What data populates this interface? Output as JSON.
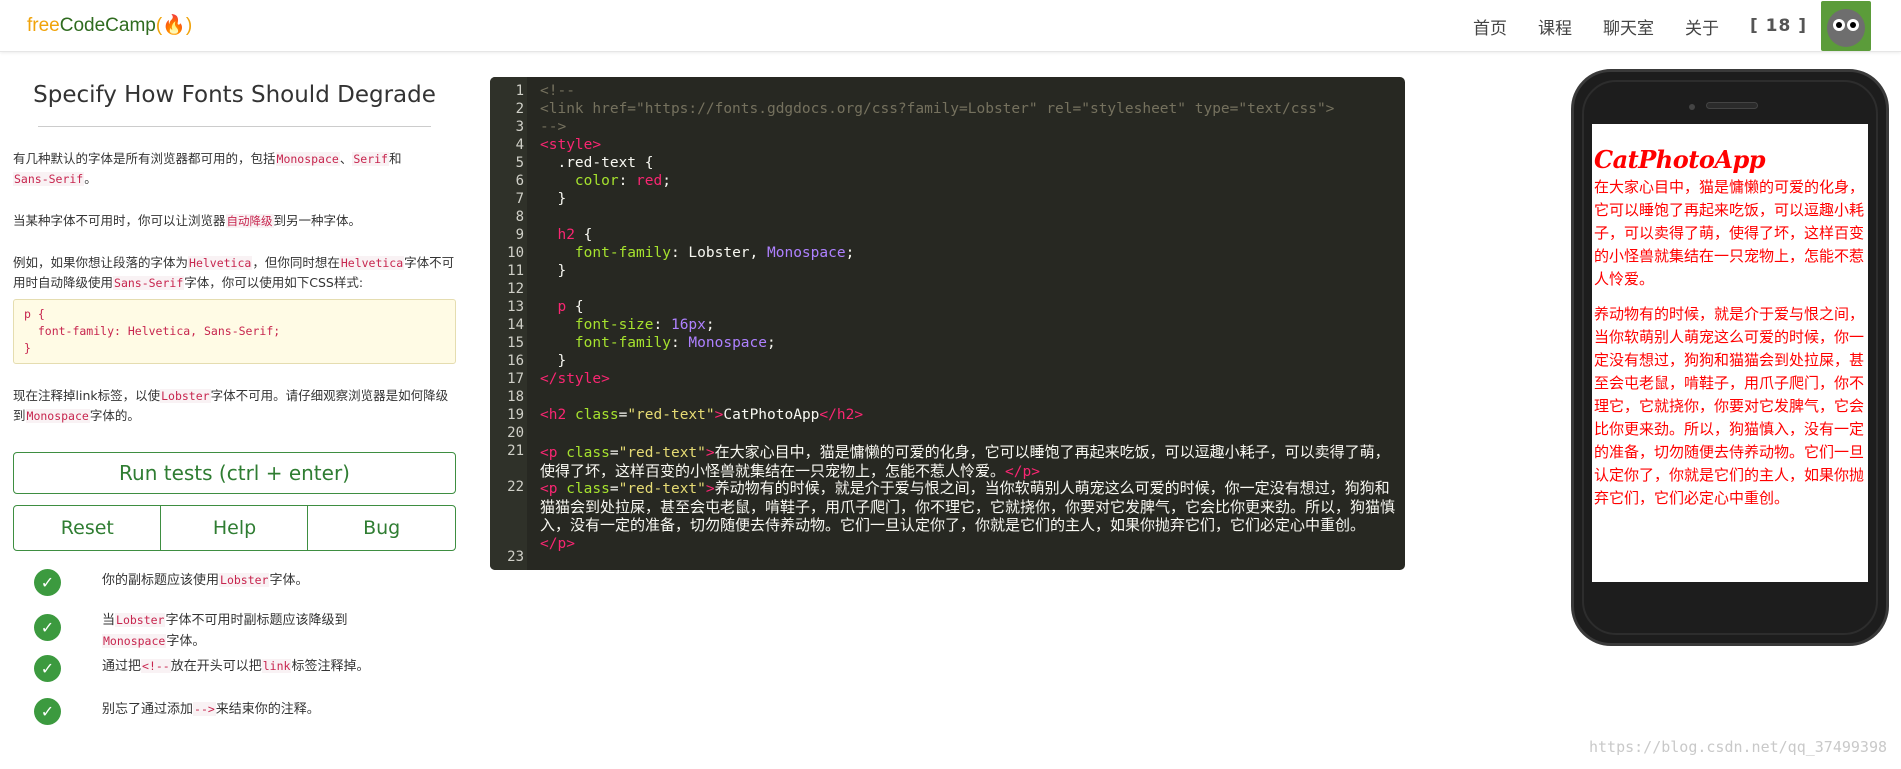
{
  "brand": {
    "part1": "free",
    "part2": "CodeCamp",
    "part3": "(🔥)"
  },
  "nav": {
    "items": [
      "首页",
      "课程",
      "聊天室",
      "关于"
    ],
    "count": "[ 18 ]"
  },
  "left": {
    "title": "Specify How Fonts Should Degrade",
    "p1": {
      "a": "有几种默认的字体是所有浏览器都可用的，包括",
      "k1": "Monospace",
      "b": "、",
      "k2": "Serif",
      "c": "和",
      "k3": "Sans-Serif",
      "d": "。"
    },
    "p2": {
      "a": "当某种字体不可用时，你可以让浏览器",
      "k1": "自动降级",
      "b": "到另一种字体。"
    },
    "p3": {
      "a": "例如，如果你想让段落的字体为",
      "k1": "Helvetica",
      "b": "，但你同时想在",
      "k2": "Helvetica",
      "c": "字体不可用时自动降级使用",
      "k3": "Sans-Serif",
      "d": "字体，你可以使用如下CSS样式:"
    },
    "code": [
      "p {",
      "  font-family: Helvetica, Sans-Serif;",
      "}"
    ],
    "p4": {
      "a": "现在注释掉link标签，以使",
      "k1": "Lobster",
      "b": "字体不可用。请仔细观察浏览器是如何降级到",
      "k2": "Monospace",
      "c": "字体的。"
    },
    "run_label": "Run tests (ctrl + enter)",
    "reset_label": "Reset",
    "help_label": "Help",
    "bug_label": "Bug",
    "tests": [
      {
        "a": "你的副标题应该使用",
        "k": "Lobster",
        "b": "字体。"
      },
      {
        "a": "当",
        "k": "Lobster",
        "b": "字体不可用时副标题应该降级到",
        "k2": "Monospace",
        "c": "字体。"
      },
      {
        "a": "通过把",
        "k": "<!--",
        "b": "放在开头可以把",
        "k2": "link",
        "c": "标签注释掉。"
      },
      {
        "a": "别忘了通过添加",
        "k": "-->",
        "b": "来结束你的注释。"
      }
    ]
  },
  "editor": {
    "line1": "<!--",
    "line2": "<link href=\"https://fonts.gdgdocs.org/css?family=Lobster\" rel=\"stylesheet\" type=\"text/css\">",
    "line3": "-->",
    "line4": "<style>",
    "line5": "  .red-text {",
    "line6_prop": "    color",
    "line6_val": "red",
    "line7": "  }",
    "line9": "  h2 {",
    "line10_prop": "    font-family",
    "line10_val1": "Lobster",
    "line10_val2": "Monospace",
    "line11": "  }",
    "line13": "  p {",
    "line14_prop": "    font-size",
    "line14_val": "16px",
    "line15_prop": "    font-family",
    "line15_val": "Monospace",
    "line16": "  }",
    "line17": "</style>",
    "line19_open": "<h2",
    "line19_attr": "class",
    "line19_str": "\"red-text\"",
    "line19_text": "CatPhotoApp",
    "line19_close": "</h2>",
    "line21_open": "<p",
    "line21_attr": "class",
    "line21_str": "\"red-text\"",
    "line21_text": "在大家心目中，猫是慵懒的可爱的化身，它可以睡饱了再起来吃饭，可以逗趣小耗子，可以卖得了萌，使得了坏，这样百变的小怪兽就集结在一只宠物上，怎能不惹人怜爱。",
    "line22_text": "养动物有的时候，就是介于爱与恨之间，当你软萌别人萌宠这么可爱的时候，你一定没有想过，狗狗和猫猫会到处拉屎，甚至会屯老鼠，啃鞋子，用爪子爬门，你不理它，它就挠你，你要对它发脾气，它会比你更来劲。所以，狗猫慎入，没有一定的准备，切勿随便去侍养动物。它们一旦认定你了，你就是它们的主人，如果你抛弃它们，它们必定心中重创。",
    "p_close": "</p>",
    "line_numbers": [
      "1",
      "2",
      "3",
      "4",
      "5",
      "6",
      "7",
      "8",
      "9",
      "10",
      "11",
      "12",
      "13",
      "14",
      "15",
      "16",
      "17",
      "18",
      "19",
      "20",
      "21",
      "22",
      "23"
    ]
  },
  "preview": {
    "h2": "CatPhotoApp",
    "p1": "在大家心目中，猫是慵懒的可爱的化身，它可以睡饱了再起来吃饭，可以逗趣小耗子，可以卖得了萌，使得了坏，这样百变的小怪兽就集结在一只宠物上，怎能不惹人怜爱。",
    "p2": "养动物有的时候，就是介于爱与恨之间，当你软萌别人萌宠这么可爱的时候，你一定没有想过，狗狗和猫猫会到处拉屎，甚至会屯老鼠，啃鞋子，用爪子爬门，你不理它，它就挠你，你要对它发脾气，它会比你更来劲。所以，狗猫慎入，没有一定的准备，切勿随便去侍养动物。它们一旦认定你了，你就是它们的主人，如果你抛弃它们，它们必定心中重创。"
  },
  "watermark": "https://blog.csdn.net/qq_37499398",
  "colors": {
    "accent_green": "#3e8e41",
    "code_red": "#c7254e",
    "editor_bg": "#272822",
    "preview_red": "#ff0000"
  }
}
